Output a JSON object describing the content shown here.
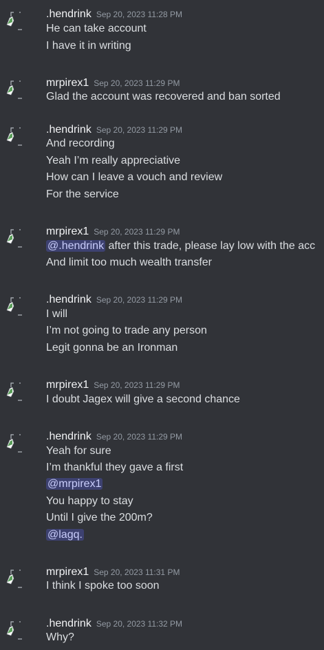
{
  "colors": {
    "background": "#313338",
    "author": "#f2f3f5",
    "text": "#dbdee1",
    "timestamp": "#949ba4",
    "mention_bg": "#3c4270",
    "mention_text": "#c9cdfb",
    "avatar_icon": "#5a9e5a"
  },
  "avatar_icon": "broken-image-icon",
  "messages": [
    {
      "author": ".hendrink",
      "time": "Sep 20, 2023 11:28 PM",
      "lines": [
        {
          "text": "He can take account"
        },
        {
          "text": "I have it in writing"
        }
      ]
    },
    {
      "author": "mrpirex1",
      "time": "Sep 20, 2023 11:29 PM",
      "lines": [
        {
          "text": "Glad the account was recovered and ban sorted"
        }
      ]
    },
    {
      "author": ".hendrink",
      "time": "Sep 20, 2023 11:29 PM",
      "lines": [
        {
          "text": "And recording"
        },
        {
          "text": "Yeah I’m really appreciative"
        },
        {
          "text": "How can I leave a vouch and review"
        },
        {
          "text": "For the service"
        }
      ]
    },
    {
      "author": "mrpirex1",
      "time": "Sep 20, 2023 11:29 PM",
      "lines": [
        {
          "mention": "@.hendrink",
          "text": " after this trade, please lay low with the acc"
        },
        {
          "text": "And limit too much wealth transfer"
        }
      ]
    },
    {
      "author": ".hendrink",
      "time": "Sep 20, 2023 11:29 PM",
      "lines": [
        {
          "text": "I will"
        },
        {
          "text": "I’m not going to trade any person"
        },
        {
          "text": "Legit gonna be an Ironman"
        }
      ]
    },
    {
      "author": "mrpirex1",
      "time": "Sep 20, 2023 11:29 PM",
      "lines": [
        {
          "text": "I doubt Jagex will give a second chance"
        }
      ]
    },
    {
      "author": ".hendrink",
      "time": "Sep 20, 2023 11:29 PM",
      "lines": [
        {
          "text": "Yeah for sure"
        },
        {
          "text": "I’m thankful they gave a first"
        },
        {
          "mention": "@mrpirex1",
          "text": ""
        },
        {
          "text": "You happy to stay"
        },
        {
          "text": "Until I give the 200m?"
        },
        {
          "mention": "@lagq.",
          "text": ""
        }
      ]
    },
    {
      "author": "mrpirex1",
      "time": "Sep 20, 2023 11:31 PM",
      "lines": [
        {
          "text": "I think I spoke too soon"
        }
      ]
    },
    {
      "author": ".hendrink",
      "time": "Sep 20, 2023 11:32 PM",
      "lines": [
        {
          "text": "Why?"
        }
      ]
    }
  ]
}
